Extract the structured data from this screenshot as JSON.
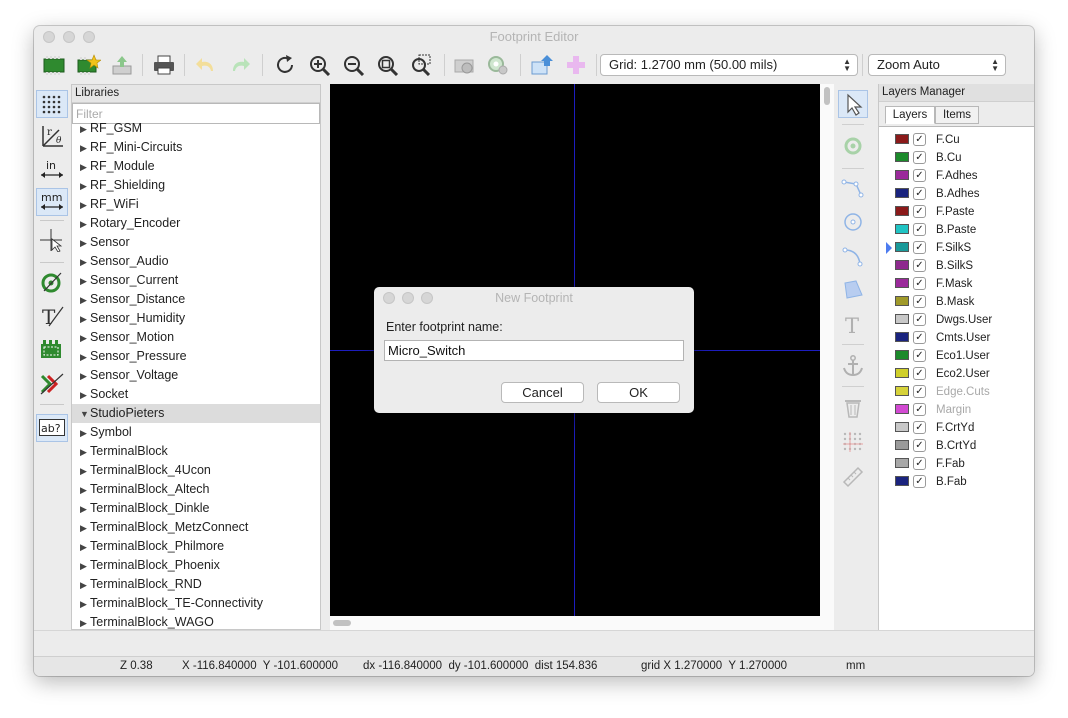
{
  "window": {
    "title": "Footprint Editor"
  },
  "toolbar": {
    "grid_select": "Grid: 1.2700 mm (50.00 mils)",
    "zoom_select": "Zoom Auto"
  },
  "libraries": {
    "header": "Libraries",
    "filter_placeholder": "Filter",
    "items": [
      {
        "label": "RF_GSM",
        "expanded": false
      },
      {
        "label": "RF_Mini-Circuits",
        "expanded": false
      },
      {
        "label": "RF_Module",
        "expanded": false
      },
      {
        "label": "RF_Shielding",
        "expanded": false
      },
      {
        "label": "RF_WiFi",
        "expanded": false
      },
      {
        "label": "Rotary_Encoder",
        "expanded": false
      },
      {
        "label": "Sensor",
        "expanded": false
      },
      {
        "label": "Sensor_Audio",
        "expanded": false
      },
      {
        "label": "Sensor_Current",
        "expanded": false
      },
      {
        "label": "Sensor_Distance",
        "expanded": false
      },
      {
        "label": "Sensor_Humidity",
        "expanded": false
      },
      {
        "label": "Sensor_Motion",
        "expanded": false
      },
      {
        "label": "Sensor_Pressure",
        "expanded": false
      },
      {
        "label": "Sensor_Voltage",
        "expanded": false
      },
      {
        "label": "Socket",
        "expanded": false
      },
      {
        "label": "StudioPieters",
        "expanded": true,
        "selected": true
      },
      {
        "label": "Symbol",
        "expanded": false
      },
      {
        "label": "TerminalBlock",
        "expanded": false
      },
      {
        "label": "TerminalBlock_4Ucon",
        "expanded": false
      },
      {
        "label": "TerminalBlock_Altech",
        "expanded": false
      },
      {
        "label": "TerminalBlock_Dinkle",
        "expanded": false
      },
      {
        "label": "TerminalBlock_MetzConnect",
        "expanded": false
      },
      {
        "label": "TerminalBlock_Philmore",
        "expanded": false
      },
      {
        "label": "TerminalBlock_Phoenix",
        "expanded": false
      },
      {
        "label": "TerminalBlock_RND",
        "expanded": false
      },
      {
        "label": "TerminalBlock_TE-Connectivity",
        "expanded": false
      },
      {
        "label": "TerminalBlock_WAGO",
        "expanded": false
      }
    ]
  },
  "left_tools": [
    "grid-dots-icon",
    "polar-coords-icon",
    "units-inch-icon",
    "units-mm-icon",
    "full-crosshair-icon",
    "pad-sketch-icon",
    "text-sketch-icon",
    "graphic-sketch-icon",
    "high-contrast-icon",
    "textbox-icon"
  ],
  "right_tools": [
    "select-arrow-icon",
    "add-pad-icon",
    "draw-line-icon",
    "draw-circle-icon",
    "draw-arc-icon",
    "draw-polygon-icon",
    "add-text-icon",
    "anchor-icon",
    "delete-icon",
    "grid-origin-icon",
    "measure-icon"
  ],
  "layers_manager": {
    "header": "Layers Manager",
    "tabs": [
      "Layers",
      "Items"
    ],
    "active_layer": "F.SilkS",
    "layers": [
      {
        "name": "F.Cu",
        "color": "#8b1a1a",
        "checked": true,
        "enabled": true
      },
      {
        "name": "B.Cu",
        "color": "#1c8a2b",
        "checked": true,
        "enabled": true
      },
      {
        "name": "F.Adhes",
        "color": "#9b2a9b",
        "checked": true,
        "enabled": true
      },
      {
        "name": "B.Adhes",
        "color": "#1a237e",
        "checked": true,
        "enabled": true
      },
      {
        "name": "F.Paste",
        "color": "#8b1a1a",
        "checked": true,
        "enabled": true
      },
      {
        "name": "B.Paste",
        "color": "#20c4c4",
        "checked": true,
        "enabled": true
      },
      {
        "name": "F.SilkS",
        "color": "#1a9a9a",
        "checked": true,
        "enabled": true
      },
      {
        "name": "B.SilkS",
        "color": "#8e2a8e",
        "checked": true,
        "enabled": true
      },
      {
        "name": "F.Mask",
        "color": "#9b2a9b",
        "checked": true,
        "enabled": true
      },
      {
        "name": "B.Mask",
        "color": "#a09a2a",
        "checked": true,
        "enabled": true
      },
      {
        "name": "Dwgs.User",
        "color": "#c8c8c8",
        "checked": true,
        "enabled": true
      },
      {
        "name": "Cmts.User",
        "color": "#1a237e",
        "checked": true,
        "enabled": true
      },
      {
        "name": "Eco1.User",
        "color": "#1c8a2b",
        "checked": true,
        "enabled": true
      },
      {
        "name": "Eco2.User",
        "color": "#cfcf2a",
        "checked": true,
        "enabled": true
      },
      {
        "name": "Edge.Cuts",
        "color": "#d6d23a",
        "checked": true,
        "enabled": false
      },
      {
        "name": "Margin",
        "color": "#d24ad2",
        "checked": true,
        "enabled": false
      },
      {
        "name": "F.CrtYd",
        "color": "#c8c8c8",
        "checked": true,
        "enabled": true
      },
      {
        "name": "B.CrtYd",
        "color": "#9a9a9a",
        "checked": true,
        "enabled": true
      },
      {
        "name": "F.Fab",
        "color": "#a8a8a8",
        "checked": true,
        "enabled": true
      },
      {
        "name": "B.Fab",
        "color": "#1a237e",
        "checked": true,
        "enabled": true
      }
    ]
  },
  "status": {
    "zoom": "Z 0.38",
    "xy": "X -116.840000  Y -101.600000",
    "dxdy": "dx -116.840000  dy -101.600000  dist 154.836",
    "grid": "grid X 1.270000  Y 1.270000",
    "units": "mm"
  },
  "dialog": {
    "title": "New Footprint",
    "prompt": "Enter footprint name:",
    "value": "Micro_Switch",
    "cancel": "Cancel",
    "ok": "OK"
  },
  "colors": {
    "canvas_bg": "#000000",
    "crosshair": "#1d1dbf",
    "selection": "#dcdcdc"
  }
}
